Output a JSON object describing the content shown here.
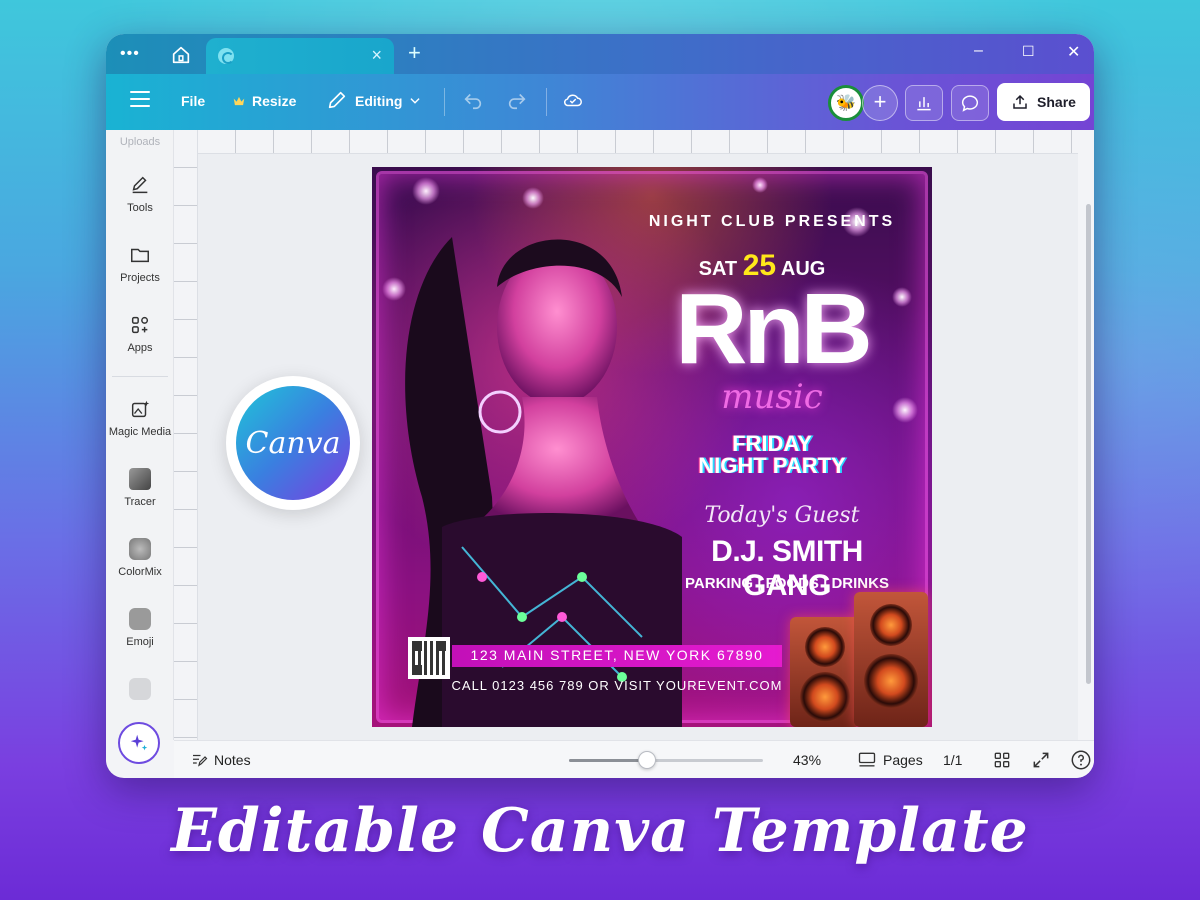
{
  "tabs": {
    "close_glyph": "×",
    "new_glyph": "+"
  },
  "window_controls": {
    "minimize": "–",
    "maximize": "☐",
    "close": "✕"
  },
  "toolbar": {
    "file_label": "File",
    "resize_label": "Resize",
    "editing_label": "Editing",
    "share_label": "Share",
    "add_glyph": "+"
  },
  "sidebar": {
    "top_partial_label": "Uploads",
    "items": [
      {
        "label": "Tools",
        "icon": "pencil-icon"
      },
      {
        "label": "Projects",
        "icon": "folder-icon"
      },
      {
        "label": "Apps",
        "icon": "apps-grid-icon"
      },
      {
        "label": "Magic Media",
        "icon": "magic-media-icon"
      },
      {
        "label": "Tracer",
        "icon": "tracer-app-icon"
      },
      {
        "label": "ColorMix",
        "icon": "colormix-app-icon"
      },
      {
        "label": "Emoji",
        "icon": "emoji-app-icon"
      }
    ]
  },
  "canva_badge": {
    "text": "Canva"
  },
  "poster": {
    "presents": "NIGHT CLUB PRESENTS",
    "date_prefix": "SAT",
    "date_day": "25",
    "date_suffix": "AUG",
    "title": "RnB",
    "subtitle": "music",
    "event_line1": "FRIDAY",
    "event_line2": "NIGHT PARTY",
    "guest_script": "Today's Guest",
    "guest_name": "D.J. SMITH GANG",
    "perks": "PARKING | FOODS | DRINKS",
    "address": "123 MAIN STREET, NEW YORK 67890",
    "contact": "CALL 0123 456 789 OR VISIT YOUREVENT.COM"
  },
  "bottombar": {
    "notes_label": "Notes",
    "zoom_value": "43%",
    "zoom_fraction": 0.4,
    "pages_label": "Pages",
    "page_count": "1/1"
  },
  "caption": "Editable Canva Template",
  "colors": {
    "accent_purple": "#7b3ee0",
    "accent_cyan": "#1fc5d8",
    "date_yellow": "#ffe81a",
    "neon_pink": "#e51bd0"
  }
}
